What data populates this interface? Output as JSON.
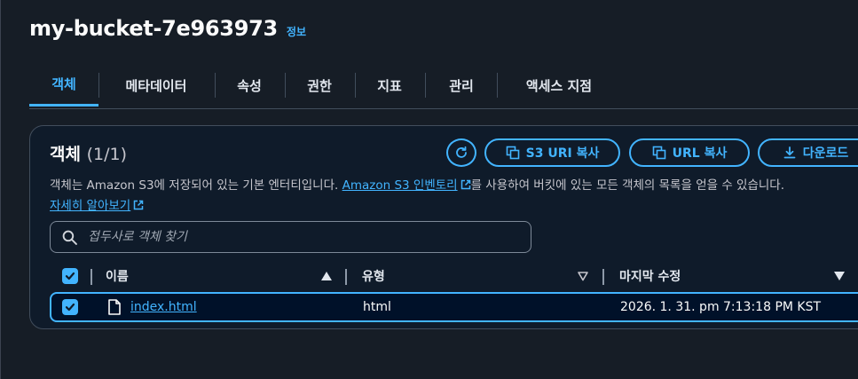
{
  "bucket": {
    "name": "my-bucket-7e963973",
    "info_label": "정보"
  },
  "tabs": [
    {
      "label": "객체",
      "active": true
    },
    {
      "label": "메타데이터"
    },
    {
      "label": "속성"
    },
    {
      "label": "권한"
    },
    {
      "label": "지표"
    },
    {
      "label": "관리"
    },
    {
      "label": "액세스 지점"
    }
  ],
  "objects_panel": {
    "title": "객체",
    "count": "(1/1)",
    "description_before": "객체는 Amazon S3에 저장되어 있는 기본 엔터티입니다. ",
    "inventory_link": "Amazon S3 인벤토리",
    "description_after": "를 사용하여 버킷에 있는 모든 객체의 목록을 얻을 수 있습니다.",
    "learn_more": "자세히 알아보기",
    "buttons": {
      "refresh_icon": "refresh-icon",
      "copy_s3_uri": "S3 URI 복사",
      "copy_url": "URL 복사",
      "download": "다운로드"
    },
    "search": {
      "placeholder": "접두사로 객체 찾기",
      "value": ""
    },
    "columns": [
      "이름",
      "유형",
      "마지막 수정"
    ],
    "rows": [
      {
        "name": "index.html",
        "type": "html",
        "last_modified": "2026. 1. 31. pm 7:13:18 PM KST",
        "selected": true
      }
    ]
  },
  "colors": {
    "background": "#161d26",
    "accent": "#42b4ff",
    "panel": "#0f1b2a",
    "text": "#fbfbfb"
  }
}
